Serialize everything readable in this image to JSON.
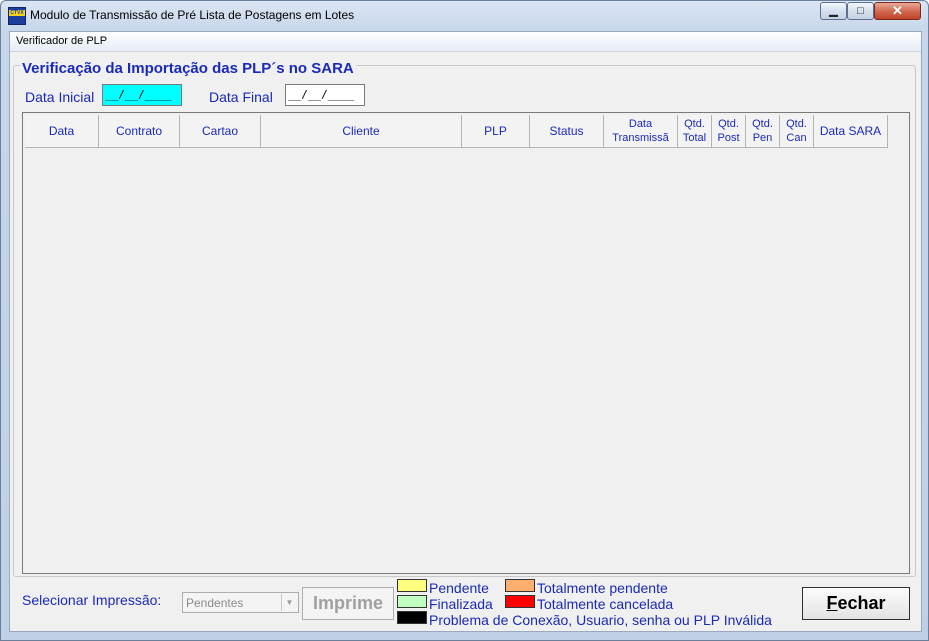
{
  "window": {
    "title": "Modulo de Transmissão de Pré Lista de Postagens em Lotes",
    "icon": "correios-app-icon",
    "icon_text": "CTVX"
  },
  "controls": {
    "minimize": "▁",
    "maximize": "□",
    "close": "✕"
  },
  "menu": {
    "items": [
      "Verificador de PLP"
    ]
  },
  "group": {
    "title": "Verificação da Importação das PLP´s no SARA"
  },
  "filters": {
    "data_inicial_label": "Data Inicial",
    "data_inicial_value": "__/__/____",
    "data_final_label": "Data Final",
    "data_final_value": "__/__/____"
  },
  "grid": {
    "columns": [
      "Data",
      "Contrato",
      "Cartao",
      "Cliente",
      "PLP",
      "Status",
      "Data\nTransmissã",
      "Qtd.\nTotal",
      "Qtd.\nPost",
      "Qtd.\nPen",
      "Qtd.\nCan",
      "Data SARA"
    ],
    "rows": []
  },
  "footer": {
    "selecionar_label": "Selecionar Impressão:",
    "selecionar_value": "Pendentes",
    "imprime_label": "Imprime",
    "fechar_label": "Fechar"
  },
  "legend": [
    {
      "label": "Pendente",
      "color": "#ffff80"
    },
    {
      "label": "Finalizada",
      "color": "#c0ffc0"
    },
    {
      "label": "Totalmente pendente",
      "color": "#ffb070"
    },
    {
      "label": "Totalmente cancelada",
      "color": "#ff0000"
    },
    {
      "label": "Problema de Conexão, Usuario, senha ou PLP Inválida",
      "color": "#000000"
    }
  ],
  "colors": {
    "accent": "#1a2ab8",
    "date_highlight": "#00ffff"
  }
}
